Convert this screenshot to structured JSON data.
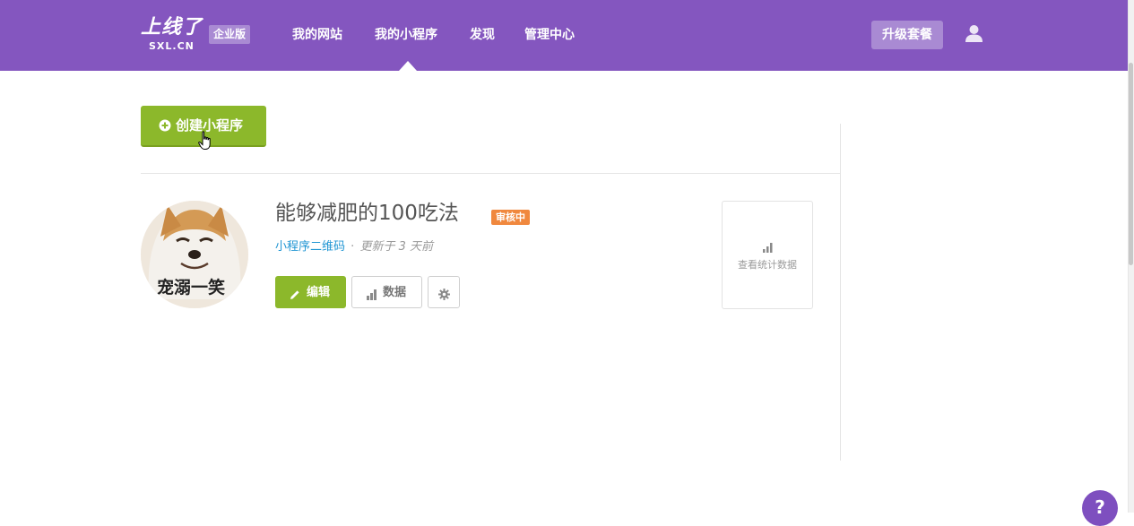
{
  "header": {
    "logo_text": "上线了",
    "logo_subtext": "SXL.CN",
    "edition_badge": "企业版",
    "nav": [
      {
        "label": "我的网站"
      },
      {
        "label": "我的小程序"
      },
      {
        "label": "发现"
      },
      {
        "label": "管理中心"
      }
    ],
    "upgrade_label": "升级套餐",
    "brand_color": "#8456bf"
  },
  "toolbar": {
    "create_label": "创建小程序"
  },
  "app": {
    "title": "能够减肥的100吃法",
    "status": "审核中",
    "qr_link": "小程序二维码",
    "meta_separator": "·",
    "updated": "更新于 3 天前",
    "avatar_caption": "宠溺一笑",
    "edit_label": "编辑",
    "data_label": "数据",
    "stats_label": "查看统计数据"
  },
  "help": {
    "label": "?"
  },
  "colors": {
    "accent_green": "#8cb82b",
    "status_orange": "#f0883e",
    "link_blue": "#2196d3"
  }
}
